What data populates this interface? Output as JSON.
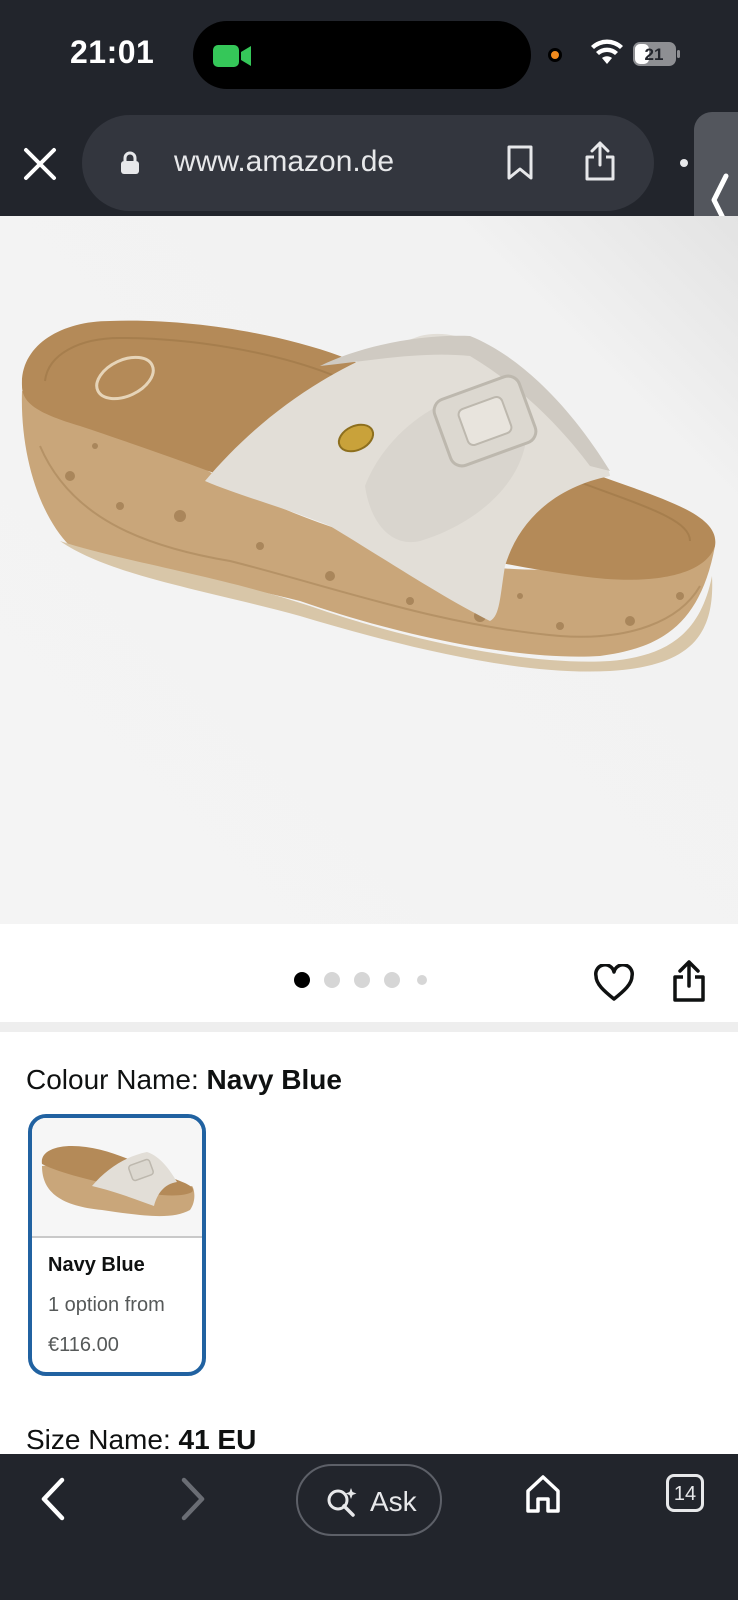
{
  "status_bar": {
    "time": "21:01",
    "battery": "21",
    "colors": {
      "camera": "#35c759",
      "recording_dot": "#f08a1d"
    }
  },
  "browser": {
    "url": "www.amazon.de",
    "close_icon": "close-icon",
    "lock_icon": "lock-icon",
    "bookmark_icon": "bookmark-icon",
    "share_icon": "share-icon",
    "side_panel_icon": "chevron-left-icon"
  },
  "product": {
    "image_alt_icon": "sandal-image",
    "carousel": {
      "total": 5,
      "active_index": 0
    },
    "actions": {
      "wishlist_icon": "heart-icon",
      "share_icon": "share-icon"
    }
  },
  "colour": {
    "label": "Colour Name:",
    "value": "Navy Blue",
    "options": [
      {
        "name": "Navy Blue",
        "availability": "1 option from",
        "price": "€116.00",
        "selected": true
      }
    ],
    "accent": "#2162a1"
  },
  "size": {
    "label": "Size Name:",
    "value": "41 EU"
  },
  "toolbar": {
    "back_icon": "chevron-left-icon",
    "forward_icon": "chevron-right-icon",
    "ask_label": "Ask",
    "ask_icon": "sparkle-search-icon",
    "home_icon": "home-icon",
    "tabs_count": "14"
  }
}
